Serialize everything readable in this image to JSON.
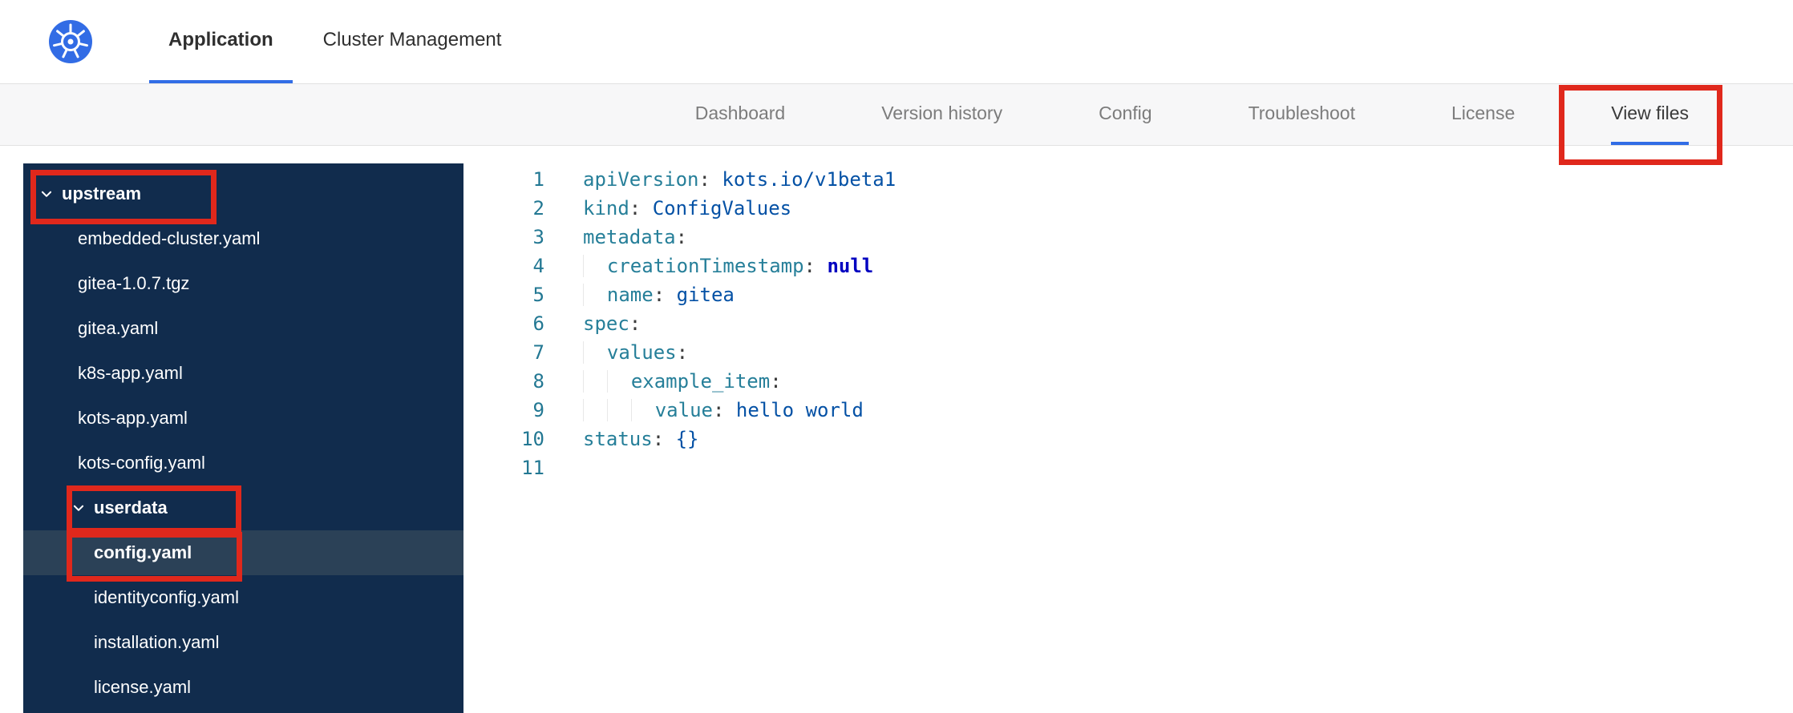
{
  "colors": {
    "annotation": "#e0281c",
    "accent_blue": "#326de6",
    "sidebar_bg": "#112c4d",
    "sidebar_selected_bg": "#2b4157",
    "kubernetes_blue": "#326ce5"
  },
  "header": {
    "logo_icon": "kubernetes-logo",
    "tabs": [
      {
        "label": "Application",
        "active": true
      },
      {
        "label": "Cluster Management",
        "active": false
      }
    ]
  },
  "subnav": {
    "tabs": [
      {
        "label": "Dashboard",
        "active": false,
        "annotated": false
      },
      {
        "label": "Version history",
        "active": false,
        "annotated": false
      },
      {
        "label": "Config",
        "active": false,
        "annotated": false
      },
      {
        "label": "Troubleshoot",
        "active": false,
        "annotated": false
      },
      {
        "label": "License",
        "active": false,
        "annotated": false
      },
      {
        "label": "View files",
        "active": true,
        "annotated": true
      }
    ]
  },
  "file_tree": {
    "items": [
      {
        "label": "upstream",
        "kind": "folder",
        "depth": 0,
        "expanded": true,
        "selected": false,
        "annotated": true
      },
      {
        "label": "embedded-cluster.yaml",
        "kind": "file",
        "depth": 1,
        "selected": false,
        "annotated": false
      },
      {
        "label": "gitea-1.0.7.tgz",
        "kind": "file",
        "depth": 1,
        "selected": false,
        "annotated": false
      },
      {
        "label": "gitea.yaml",
        "kind": "file",
        "depth": 1,
        "selected": false,
        "annotated": false
      },
      {
        "label": "k8s-app.yaml",
        "kind": "file",
        "depth": 1,
        "selected": false,
        "annotated": false
      },
      {
        "label": "kots-app.yaml",
        "kind": "file",
        "depth": 1,
        "selected": false,
        "annotated": false
      },
      {
        "label": "kots-config.yaml",
        "kind": "file",
        "depth": 1,
        "selected": false,
        "annotated": false
      },
      {
        "label": "userdata",
        "kind": "folder",
        "depth": 1,
        "expanded": true,
        "selected": false,
        "annotated": true
      },
      {
        "label": "config.yaml",
        "kind": "file",
        "depth": 2,
        "selected": true,
        "annotated": true
      },
      {
        "label": "identityconfig.yaml",
        "kind": "file",
        "depth": 2,
        "selected": false,
        "annotated": false
      },
      {
        "label": "installation.yaml",
        "kind": "file",
        "depth": 2,
        "selected": false,
        "annotated": false
      },
      {
        "label": "license.yaml",
        "kind": "file",
        "depth": 2,
        "selected": false,
        "annotated": false
      }
    ]
  },
  "editor": {
    "language": "yaml",
    "lines": [
      {
        "num": "1",
        "tokens": [
          [
            "key",
            "apiVersion"
          ],
          [
            "p",
            ": "
          ],
          [
            "val",
            "kots.io/v1beta1"
          ]
        ]
      },
      {
        "num": "2",
        "tokens": [
          [
            "key",
            "kind"
          ],
          [
            "p",
            ": "
          ],
          [
            "val",
            "ConfigValues"
          ]
        ]
      },
      {
        "num": "3",
        "tokens": [
          [
            "key",
            "metadata"
          ],
          [
            "p",
            ":"
          ]
        ]
      },
      {
        "num": "4",
        "tokens": [
          [
            "ind",
            "  "
          ],
          [
            "key",
            "creationTimestamp"
          ],
          [
            "p",
            ": "
          ],
          [
            "kw",
            "null"
          ]
        ]
      },
      {
        "num": "5",
        "tokens": [
          [
            "ind",
            "  "
          ],
          [
            "key",
            "name"
          ],
          [
            "p",
            ": "
          ],
          [
            "val",
            "gitea"
          ]
        ]
      },
      {
        "num": "6",
        "tokens": [
          [
            "key",
            "spec"
          ],
          [
            "p",
            ":"
          ]
        ]
      },
      {
        "num": "7",
        "tokens": [
          [
            "ind",
            "  "
          ],
          [
            "key",
            "values"
          ],
          [
            "p",
            ":"
          ]
        ]
      },
      {
        "num": "8",
        "tokens": [
          [
            "ind",
            "  "
          ],
          [
            "ind",
            "  "
          ],
          [
            "key",
            "example_item"
          ],
          [
            "p",
            ":"
          ]
        ]
      },
      {
        "num": "9",
        "tokens": [
          [
            "ind",
            "  "
          ],
          [
            "ind",
            "  "
          ],
          [
            "ind",
            "  "
          ],
          [
            "key",
            "value"
          ],
          [
            "p",
            ": "
          ],
          [
            "val",
            "hello world"
          ]
        ]
      },
      {
        "num": "10",
        "tokens": [
          [
            "key",
            "status"
          ],
          [
            "p",
            ": "
          ],
          [
            "val",
            "{}"
          ]
        ]
      },
      {
        "num": "11",
        "tokens": []
      }
    ]
  },
  "annotations": [
    {
      "target": "view-files-tab"
    },
    {
      "target": "upstream-folder"
    },
    {
      "target": "userdata-folder"
    },
    {
      "target": "config-yaml-file"
    }
  ]
}
